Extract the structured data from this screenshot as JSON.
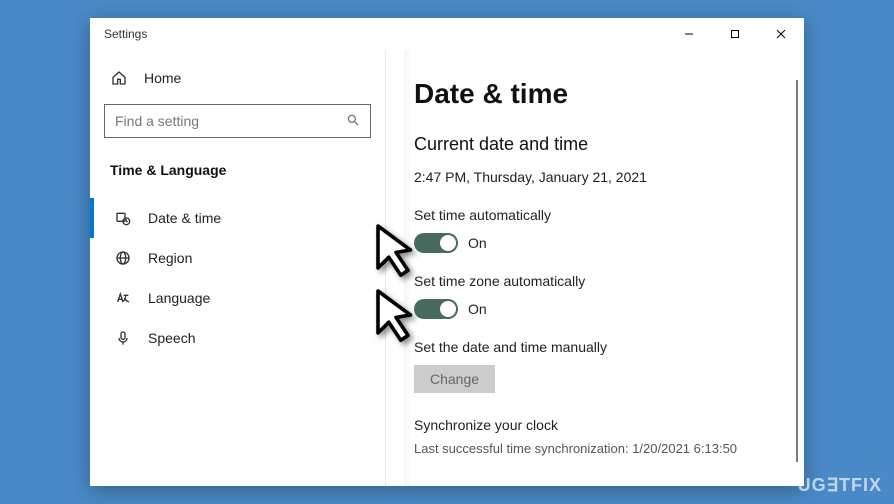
{
  "window": {
    "title": "Settings"
  },
  "sidebar": {
    "home_label": "Home",
    "search_placeholder": "Find a setting",
    "section_label": "Time & Language",
    "items": [
      {
        "label": "Date & time"
      },
      {
        "label": "Region"
      },
      {
        "label": "Language"
      },
      {
        "label": "Speech"
      }
    ]
  },
  "main": {
    "heading": "Date & time",
    "subheading": "Current date and time",
    "current_datetime": "2:47 PM, Thursday, January 21, 2021",
    "set_time_auto_label": "Set time automatically",
    "set_time_auto_state": "On",
    "set_tz_auto_label": "Set time zone automatically",
    "set_tz_auto_state": "On",
    "set_manual_label": "Set the date and time manually",
    "change_button": "Change",
    "sync_heading": "Synchronize your clock",
    "sync_info": "Last successful time synchronization: 1/20/2021 6:13:50"
  },
  "watermark": "UG∃TFIX"
}
